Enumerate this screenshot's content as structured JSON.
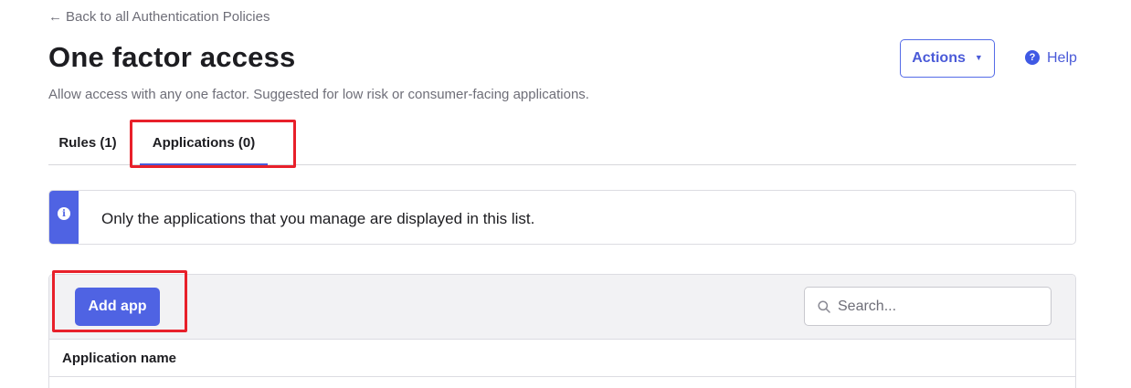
{
  "nav": {
    "back_arrow": "←",
    "back_label": "Back to all Authentication Policies"
  },
  "header": {
    "title": "One factor access",
    "description": "Allow access with any one factor. Suggested for low risk or consumer-facing applications.",
    "actions_label": "Actions",
    "actions_caret": "▼",
    "help_label": "Help",
    "help_icon_glyph": "?"
  },
  "tabs": [
    {
      "label": "Rules (1)",
      "active": false
    },
    {
      "label": "Applications (0)",
      "active": true
    }
  ],
  "info": {
    "icon_glyph": "i",
    "message": "Only the applications that you manage are displayed in this list."
  },
  "table": {
    "add_button_label": "Add app",
    "search_placeholder": "Search...",
    "columns": [
      "Application name"
    ]
  },
  "colors": {
    "accent": "#4f63e3",
    "link": "#4a5ad8",
    "annotation": "#e8202a"
  }
}
